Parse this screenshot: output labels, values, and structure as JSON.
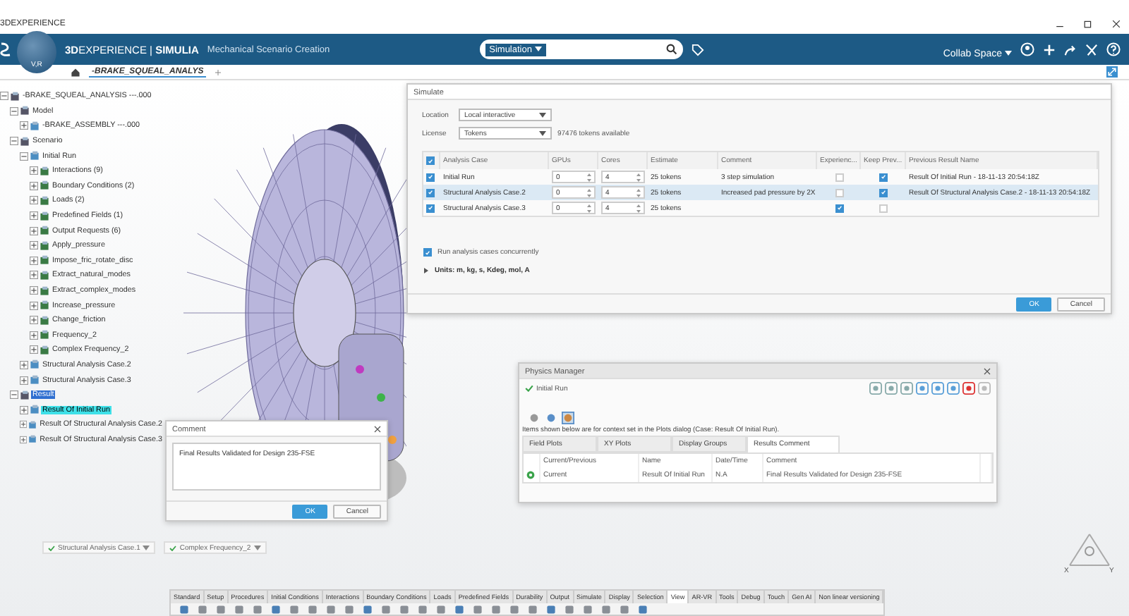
{
  "app_title": "3DEXPERIENCE",
  "header": {
    "brand": "**3D**EXPERIENCE | **SIMULIA**",
    "app_name": "Mechanical Scenario Creation",
    "compass_label": "V,R",
    "search_scope": "Simulation",
    "collab_space": "Collab Space"
  },
  "doc_tabs": [
    {
      "label": "-BRAKE_SQUEAL_ANALYS",
      "selected": true
    }
  ],
  "tree": {
    "label": "-BRAKE_SQUEAL_ANALYSIS ---.000",
    "expanded": true,
    "selected": false,
    "children": [
      {
        "label": "Model",
        "expanded": true,
        "selected": false,
        "children": [
          {
            "label": "-BRAKE_ASSEMBLY ---.000",
            "expanded": false,
            "selected": false
          }
        ]
      },
      {
        "label": "Scenario",
        "expanded": true,
        "selected": false,
        "children": [
          {
            "label": "Initial Run",
            "expanded": true,
            "selected": false,
            "children": [
              {
                "label": "Interactions (9)",
                "expanded": false,
                "selected": false
              },
              {
                "label": "Boundary Conditions (2)",
                "expanded": false,
                "selected": false
              },
              {
                "label": "Loads (2)",
                "expanded": false,
                "selected": false
              },
              {
                "label": "Predefined Fields (1)",
                "expanded": false,
                "selected": false
              },
              {
                "label": "Output Requests (6)",
                "expanded": false,
                "selected": false
              },
              {
                "label": "Apply_pressure",
                "expanded": false,
                "selected": false
              },
              {
                "label": "Impose_fric_rotate_disc",
                "expanded": false,
                "selected": false
              },
              {
                "label": "Extract_natural_modes",
                "expanded": false,
                "selected": false
              },
              {
                "label": "Extract_complex_modes",
                "expanded": false,
                "selected": false
              },
              {
                "label": "Increase_pressure",
                "expanded": false,
                "selected": false
              },
              {
                "label": "Change_friction",
                "expanded": false,
                "selected": false
              },
              {
                "label": "Frequency_2",
                "expanded": false,
                "selected": false
              },
              {
                "label": "Complex Frequency_2",
                "expanded": false,
                "selected": false
              }
            ]
          },
          {
            "label": "Structural Analysis Case.2",
            "expanded": false,
            "selected": false
          },
          {
            "label": "Structural Analysis Case.3",
            "expanded": false,
            "selected": false
          }
        ]
      },
      {
        "label": "Result",
        "expanded": true,
        "selected": true,
        "children": [
          {
            "label": "Result Of Initial Run",
            "expanded": false,
            "selected": true
          },
          {
            "label": "Result Of Structural Analysis Case.2",
            "expanded": false,
            "selected": false
          },
          {
            "label": "Result Of Structural Analysis Case.3",
            "expanded": false,
            "selected": false
          }
        ]
      }
    ]
  },
  "simulate": {
    "title": "Simulate",
    "location_label": "Location",
    "location": "Local interactive",
    "license_label": "License",
    "license": "Tokens",
    "tokens_available": "97476 tokens available",
    "all_checked": true,
    "columns": [
      "Analysis Case",
      "GPUs",
      "Cores",
      "Estimate",
      "Comment",
      "Experienc...",
      "Keep Prev...",
      "Previous Result Name"
    ],
    "rows": [
      {
        "checked": true,
        "selected": false,
        "case": "Initial Run",
        "gpus": "0",
        "cores": "4",
        "estimate": "25 tokens",
        "comment": "3 step simulation",
        "experience": false,
        "keep_previous": true,
        "previous_result": "Result Of Initial Run - 18-11-13 20:54:18Z"
      },
      {
        "checked": true,
        "selected": true,
        "case": "Structural Analysis Case.2",
        "gpus": "0",
        "cores": "4",
        "estimate": "25 tokens",
        "comment": "Increased pad pressure by 2X",
        "experience": false,
        "keep_previous": true,
        "previous_result": "Result Of Structural Analysis Case.2 - 18-11-13 20:54:18Z"
      },
      {
        "checked": true,
        "selected": false,
        "case": "Structural Analysis Case.3",
        "gpus": "0",
        "cores": "4",
        "estimate": "25 tokens",
        "comment": "",
        "experience": true,
        "keep_previous": false,
        "previous_result": ""
      }
    ],
    "concurrent_label": "Run analysis cases concurrently",
    "concurrent": true,
    "units": "Units: m, kg, s, Kdeg, mol, A",
    "ok": "OK",
    "cancel": "Cancel"
  },
  "physics_manager": {
    "title": "Physics Manager",
    "status": "Initial Run",
    "info": "Items shown below are for context set in the Plots dialog (Case: Result Of Initial Run).",
    "tabs": [
      {
        "label": "Field Plots",
        "selected": false
      },
      {
        "label": "XY Plots",
        "selected": false
      },
      {
        "label": "Display Groups",
        "selected": false
      },
      {
        "label": "Results Comment",
        "selected": true
      }
    ],
    "columns": [
      "Current/Previous",
      "Name",
      "Date/Time",
      "Comment"
    ],
    "rows": [
      {
        "current": "Current",
        "name": "Result Of Initial Run",
        "date": "N.A",
        "comment": "Final Results Validated for Design 235-FSE"
      }
    ]
  },
  "comment_dialog": {
    "title": "Comment",
    "text": "Final Results Validated for Design 235-FSE",
    "ok": "OK",
    "cancel": "Cancel"
  },
  "case_chips": [
    "Structural Analysis Case.1",
    "Complex Frequency_2"
  ],
  "action_tabs": [
    {
      "label": "Standard",
      "selected": false
    },
    {
      "label": "Setup",
      "selected": false
    },
    {
      "label": "Procedures",
      "selected": false
    },
    {
      "label": "Initial Conditions",
      "selected": false
    },
    {
      "label": "Interactions",
      "selected": false
    },
    {
      "label": "Boundary Conditions",
      "selected": false
    },
    {
      "label": "Loads",
      "selected": false
    },
    {
      "label": "Predefined Fields",
      "selected": false
    },
    {
      "label": "Durability",
      "selected": false
    },
    {
      "label": "Output",
      "selected": false
    },
    {
      "label": "Simulate",
      "selected": false
    },
    {
      "label": "Display",
      "selected": false
    },
    {
      "label": "Selection",
      "selected": false
    },
    {
      "label": "View",
      "selected": true
    },
    {
      "label": "AR-VR",
      "selected": false
    },
    {
      "label": "Tools",
      "selected": false
    },
    {
      "label": "Debug",
      "selected": false
    },
    {
      "label": "Touch",
      "selected": false
    },
    {
      "label": "Gen AI",
      "selected": false
    },
    {
      "label": "Non linear versioning",
      "selected": false
    }
  ],
  "triad_labels": [
    "X",
    "Y"
  ]
}
